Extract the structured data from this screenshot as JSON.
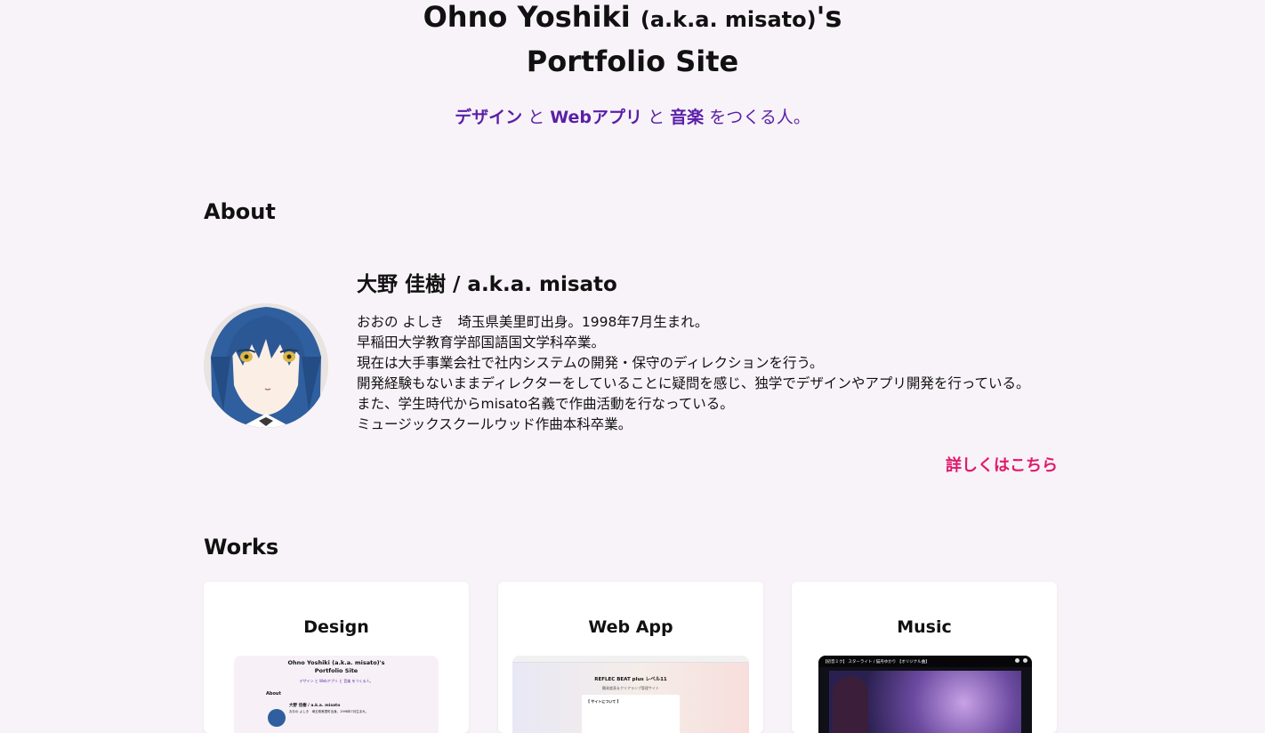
{
  "header": {
    "title_name": "Ohno Yoshiki ",
    "title_aka": "(a.k.a. misato)",
    "title_suffix": "'s",
    "title_line2": "Portfolio Site",
    "tagline": {
      "design": "デザイン",
      "and1": " と ",
      "webapp": "Webアプリ",
      "and2": " と ",
      "music": "音楽",
      "rest": " をつくる人。"
    }
  },
  "about": {
    "heading": "About",
    "name": "大野 佳樹 / a.k.a. misato",
    "bio": [
      "おおの よしき　埼玉県美里町出身。1998年7月生まれ。",
      "早稲田大学教育学部国語国文学科卒業。",
      "現在は大手事業会社で社内システムの開発・保守のディレクションを行う。",
      "開発経験もないままディレクターをしていることに疑問を感じ、独学でデザインやアプリ開発を行っている。",
      "また、学生時代からmisato名義で作曲活動を行なっている。",
      "ミュージックスクールウッド作曲本科卒業。"
    ],
    "more_link": "詳しくはこちら"
  },
  "works": {
    "heading": "Works",
    "cards": [
      {
        "title": "Design",
        "thumb": {
          "title": "Ohno Yoshiki (a.k.a. misato)'s",
          "title2": "Portfolio Site",
          "tagline": "デザイン と Webアプリ と 音楽 をつくる人。",
          "about": "About",
          "name": "大野 佳樹 / a.k.a. misato",
          "bio": "おおの よしき　埼玉県美里町出身。1998年7月生まれ。"
        }
      },
      {
        "title": "Web App",
        "thumb": {
          "title": "REFLEC BEAT plus レベル11",
          "subtitle": "難易度表＆クリアランプ管理サイト",
          "box_heading": "【 サイトについて 】"
        }
      },
      {
        "title": "Music",
        "thumb": {
          "video_title": "【初音ミク】 スターライト / 猫丹ゆかり 【オリジナル曲】"
        }
      }
    ]
  },
  "colors": {
    "background": "#f8f3f8",
    "accent_purple": "#5a1fa8",
    "link_pink": "#e0196c",
    "card_bg": "#ffffff"
  }
}
